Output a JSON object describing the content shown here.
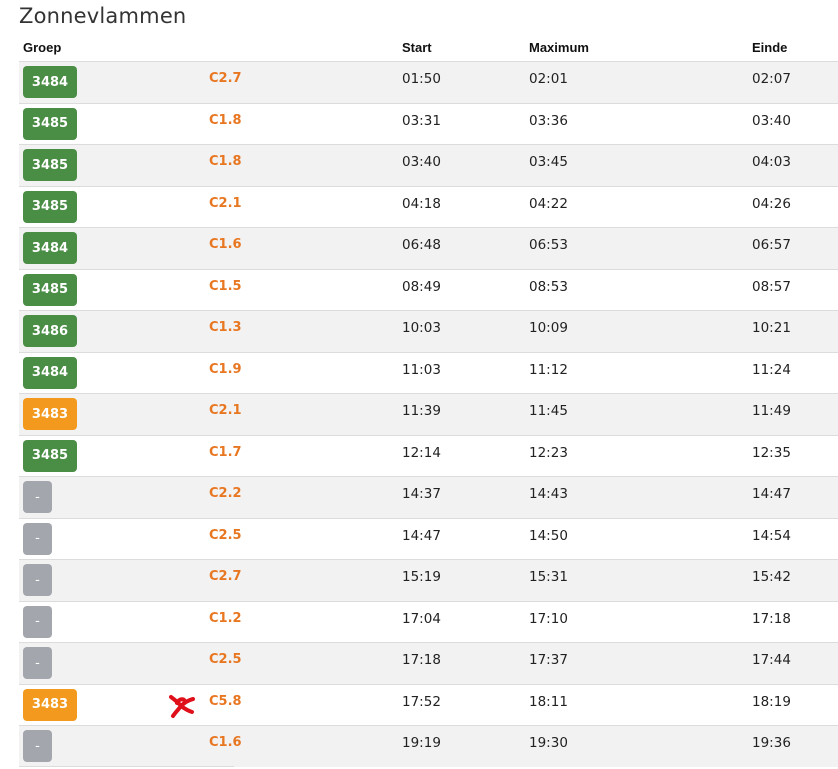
{
  "page": {
    "title": "Zonnevlammen"
  },
  "table": {
    "headers": {
      "groep": "Groep",
      "start": "Start",
      "maximum": "Maximum",
      "einde": "Einde"
    },
    "rows": [
      {
        "groep": "3484",
        "badge_color": "green",
        "klasse": "C2.7",
        "start": "01:50",
        "maximum": "02:01",
        "einde": "02:07"
      },
      {
        "groep": "3485",
        "badge_color": "green",
        "klasse": "C1.8",
        "start": "03:31",
        "maximum": "03:36",
        "einde": "03:40"
      },
      {
        "groep": "3485",
        "badge_color": "green",
        "klasse": "C1.8",
        "start": "03:40",
        "maximum": "03:45",
        "einde": "04:03"
      },
      {
        "groep": "3485",
        "badge_color": "green",
        "klasse": "C2.1",
        "start": "04:18",
        "maximum": "04:22",
        "einde": "04:26"
      },
      {
        "groep": "3484",
        "badge_color": "green",
        "klasse": "C1.6",
        "start": "06:48",
        "maximum": "06:53",
        "einde": "06:57"
      },
      {
        "groep": "3485",
        "badge_color": "green",
        "klasse": "C1.5",
        "start": "08:49",
        "maximum": "08:53",
        "einde": "08:57"
      },
      {
        "groep": "3486",
        "badge_color": "green",
        "klasse": "C1.3",
        "start": "10:03",
        "maximum": "10:09",
        "einde": "10:21"
      },
      {
        "groep": "3484",
        "badge_color": "green",
        "klasse": "C1.9",
        "start": "11:03",
        "maximum": "11:12",
        "einde": "11:24"
      },
      {
        "groep": "3483",
        "badge_color": "orange",
        "klasse": "C2.1",
        "start": "11:39",
        "maximum": "11:45",
        "einde": "11:49"
      },
      {
        "groep": "3485",
        "badge_color": "green",
        "klasse": "C1.7",
        "start": "12:14",
        "maximum": "12:23",
        "einde": "12:35"
      },
      {
        "groep": "-",
        "badge_color": "gray",
        "klasse": "C2.2",
        "start": "14:37",
        "maximum": "14:43",
        "einde": "14:47"
      },
      {
        "groep": "-",
        "badge_color": "gray",
        "klasse": "C2.5",
        "start": "14:47",
        "maximum": "14:50",
        "einde": "14:54"
      },
      {
        "groep": "-",
        "badge_color": "gray",
        "klasse": "C2.7",
        "start": "15:19",
        "maximum": "15:31",
        "einde": "15:42"
      },
      {
        "groep": "-",
        "badge_color": "gray",
        "klasse": "C1.2",
        "start": "17:04",
        "maximum": "17:10",
        "einde": "17:18"
      },
      {
        "groep": "-",
        "badge_color": "gray",
        "klasse": "C2.5",
        "start": "17:18",
        "maximum": "17:37",
        "einde": "17:44"
      },
      {
        "groep": "3483",
        "badge_color": "orange",
        "klasse": "C5.8",
        "start": "17:52",
        "maximum": "18:11",
        "einde": "18:19",
        "marked": true
      },
      {
        "groep": "-",
        "badge_color": "gray",
        "klasse": "C1.6",
        "start": "19:19",
        "maximum": "19:30",
        "einde": "19:36"
      }
    ]
  },
  "colors": {
    "badge_green": "#4a8d45",
    "badge_orange": "#f39a1e",
    "badge_gray": "#a3a6ac",
    "class_text": "#e87722",
    "marker_red": "#e0101a"
  },
  "icons": {
    "marker": "red-scribble-mark-icon"
  }
}
